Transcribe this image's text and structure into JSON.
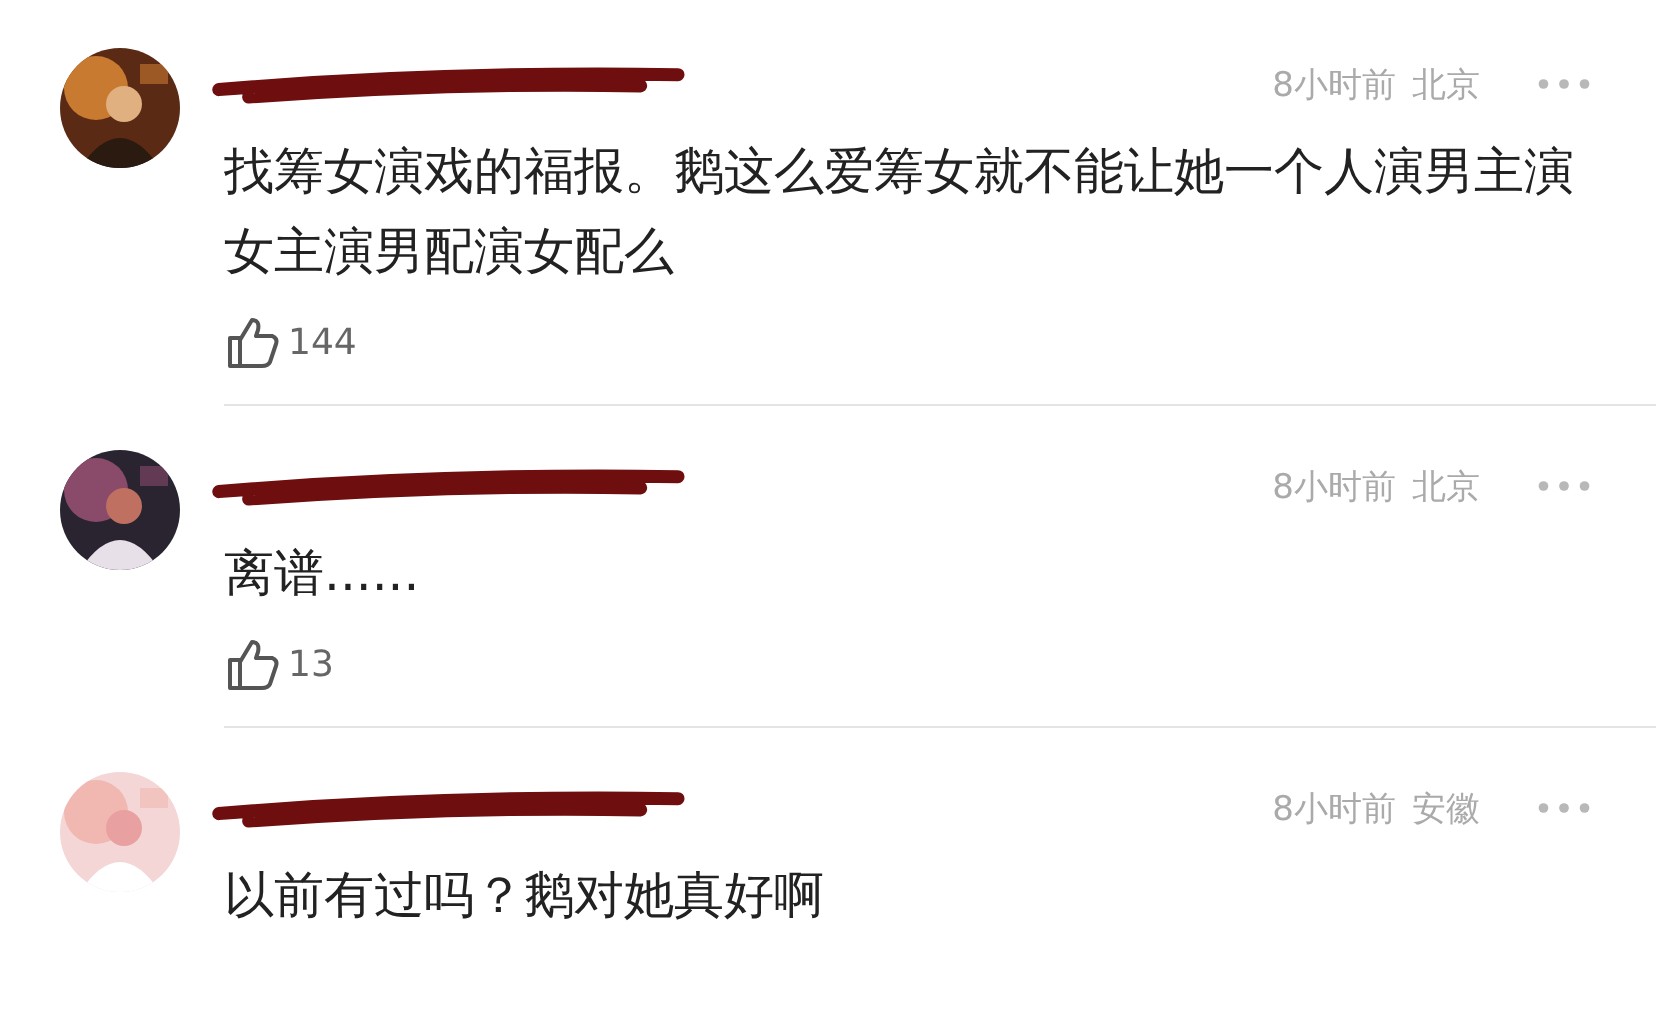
{
  "comments": [
    {
      "time": "8小时前",
      "location": "北京",
      "text": "找筹女演戏的福报。鹅这么爱筹女就不能让她一个人演男主演女主演男配演女配么",
      "likes": "144"
    },
    {
      "time": "8小时前",
      "location": "北京",
      "text": "离谱......",
      "likes": "13"
    },
    {
      "time": "8小时前",
      "location": "安徽",
      "text": "以前有过吗？鹅对她真好啊"
    }
  ]
}
